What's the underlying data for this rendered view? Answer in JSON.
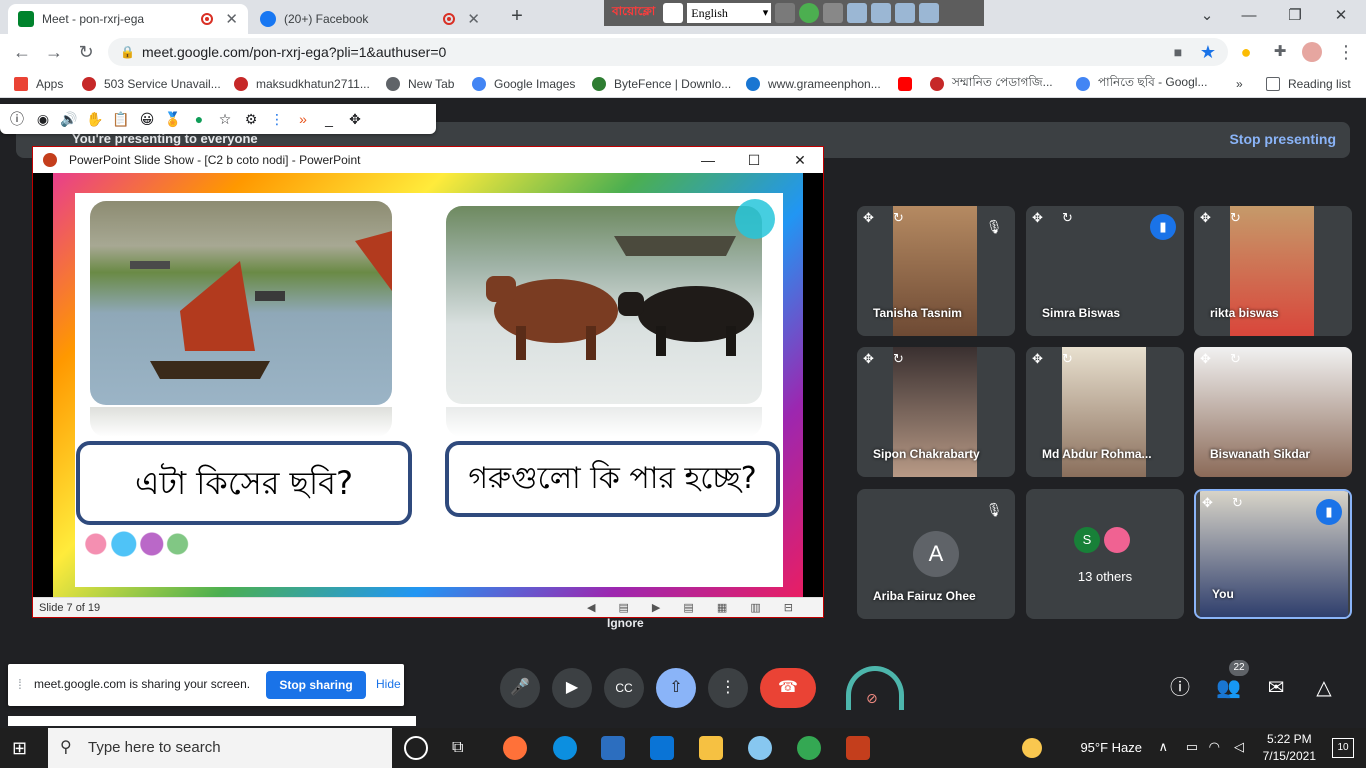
{
  "browser": {
    "tabs": [
      {
        "title": "Meet - pon-rxrj-ega",
        "active": true
      },
      {
        "title": "(20+) Facebook",
        "active": false
      }
    ],
    "url": "meet.google.com/pon-rxrj-ega?pli=1&authuser=0",
    "ime": {
      "logo": "বায়োক্লো",
      "language": "English"
    },
    "bookmarks": [
      "Apps",
      "503 Service Unavail...",
      "maksudkhatun2711...",
      "New Tab",
      "Google Images",
      "ByteFence | Downlo...",
      "www.grameenphon...",
      "সম্মানিত পেডাগজি...",
      "পানিতে ছবি - Googl...",
      "Reading list"
    ]
  },
  "presenting": {
    "banner": "You're presenting to everyone",
    "stop_label": "Stop presenting"
  },
  "ppt": {
    "window_title": "PowerPoint Slide Show - [C2 b coto nodi] - PowerPoint",
    "slide_status": "Slide 7 of 19",
    "question_left": "এটা কিসের ছবি?",
    "question_right": "গরুগুলো কি পার হচ্ছে?"
  },
  "participants": [
    {
      "name": "Tanisha Tasnim"
    },
    {
      "name": "Simra Biswas"
    },
    {
      "name": "rikta biswas"
    },
    {
      "name": "Sipon Chakrabarty"
    },
    {
      "name": "Md Abdur Rohma..."
    },
    {
      "name": "Biswanath Sikdar"
    },
    {
      "name": "Ariba Fairuz Ohee",
      "initial": "A"
    },
    {
      "name": "13 others",
      "initial": "S"
    },
    {
      "name": "You"
    }
  ],
  "share_notice": {
    "text": "meet.google.com is sharing your screen.",
    "stop_label": "Stop sharing",
    "hide_label": "Hide"
  },
  "ignore_label": "Ignore",
  "people_count": "22",
  "taskbar": {
    "search_placeholder": "Type here to search",
    "weather": "95°F  Haze",
    "time": "5:22 PM",
    "date": "7/15/2021",
    "notifications": "10"
  },
  "colors": {
    "meet_bg": "#202124",
    "tile_bg": "#3c4043",
    "accent_blue": "#1a73e8",
    "end_call_red": "#ea4335",
    "ppt_border": "#c00000"
  }
}
